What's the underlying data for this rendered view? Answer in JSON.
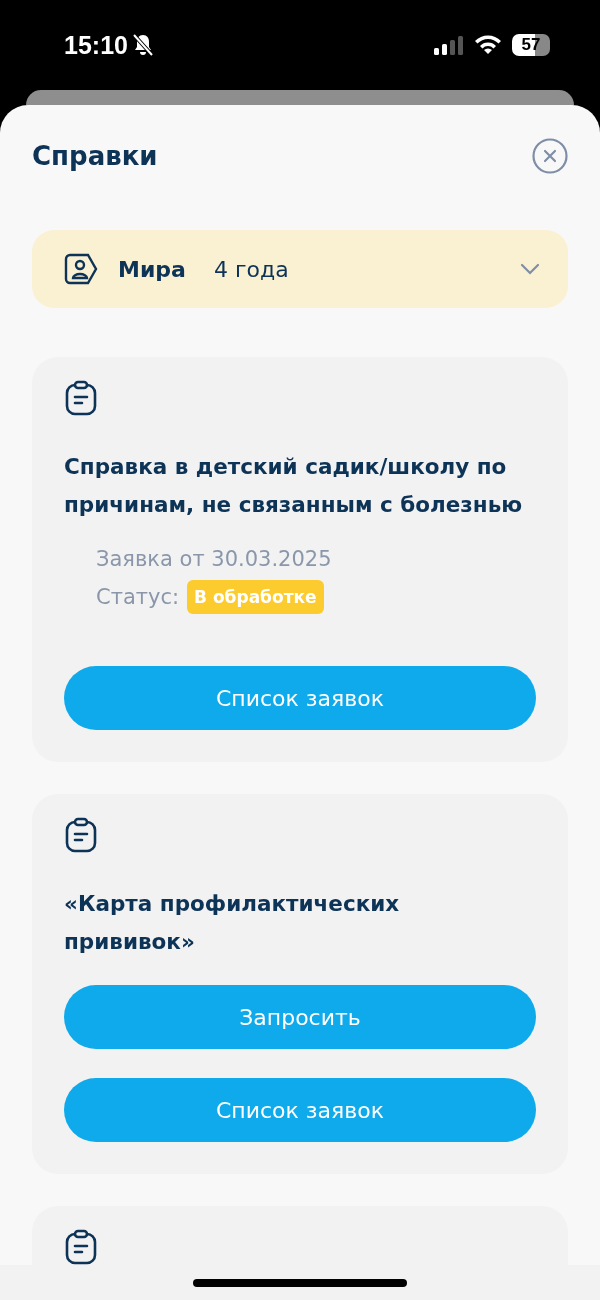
{
  "status_bar": {
    "time": "15:10",
    "battery": "57"
  },
  "title": "Справки",
  "child": {
    "name": "Мира",
    "age": "4 года"
  },
  "cards": [
    {
      "kind": "full",
      "title": "Справка в детский садик/школу по причинам, не связанным с болезнью",
      "request": "Заявка от 30.03.2025",
      "status_label": "Статус:",
      "status": "В обработке",
      "buttons": [
        "Список заявок"
      ]
    },
    {
      "kind": "full",
      "title": "«Карта профилактических прививок»",
      "buttons": [
        "Запросить",
        "Список заявок"
      ]
    },
    {
      "kind": "cut_off"
    }
  ]
}
